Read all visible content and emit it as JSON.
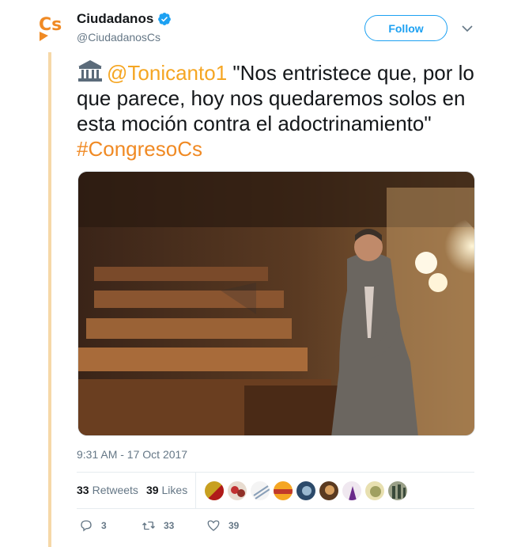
{
  "author": {
    "display_name": "Ciudadanos",
    "handle": "@CiudadanosCs",
    "logo_text": "Cs",
    "verified_icon": "verified-badge-icon"
  },
  "follow_label": "Follow",
  "tweet": {
    "emoji": "classical-building-icon",
    "mention": "@Tonicanto1",
    "text": " \"Nos entristece que, por lo que parece, hoy nos quedaremos solos en esta moción contra el adoctrinamiento\" ",
    "hashtag": "#CongresoCs"
  },
  "timestamp": "9:31 AM - 17 Oct 2017",
  "stats": {
    "retweets_count": "33",
    "retweets_label": "Retweets",
    "likes_count": "39",
    "likes_label": "Likes"
  },
  "actions": {
    "reply_count": "3",
    "retweet_count": "33",
    "like_count": "39"
  },
  "colors": {
    "brand_orange": "#f08a24",
    "link_blue": "#1da1f2",
    "thread_line": "#f6d8a8"
  }
}
